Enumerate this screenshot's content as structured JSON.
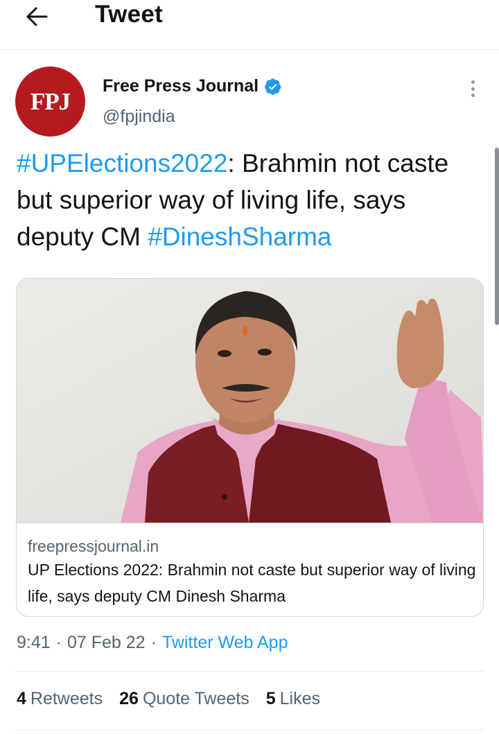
{
  "header": {
    "title": "Tweet",
    "back_icon": "arrow-left-icon"
  },
  "author": {
    "avatar_text": "FPJ",
    "name": "Free Press Journal",
    "handle": "@fpjindia",
    "verified_icon": "verified-badge-icon",
    "more_icon": "more-vertical-icon"
  },
  "tweet": {
    "hashtag1": "#UPElections2022",
    "text1": ": Brahmin not caste but superior way of living life, says  deputy CM ",
    "hashtag2": "#DineshSharma"
  },
  "card": {
    "image_alt": "photo of a man in a pink kurta and maroon jacket raising his hand",
    "domain": "freepressjournal.in",
    "title": "UP Elections 2022: Brahmin not caste but superior way of living life, says deputy CM Dinesh Sharma"
  },
  "meta": {
    "time": "9:41",
    "date": "07 Feb 22",
    "separator": "·",
    "source": "Twitter Web App"
  },
  "stats": {
    "retweets_count": "4",
    "retweets_label": "Retweets",
    "quote_tweets_count": "26",
    "quote_tweets_label": "Quote Tweets",
    "likes_count": "5",
    "likes_label": "Likes"
  },
  "colors": {
    "link": "#1d9bf0",
    "secondary_text": "#536471",
    "avatar_bg": "#b51a1f"
  }
}
